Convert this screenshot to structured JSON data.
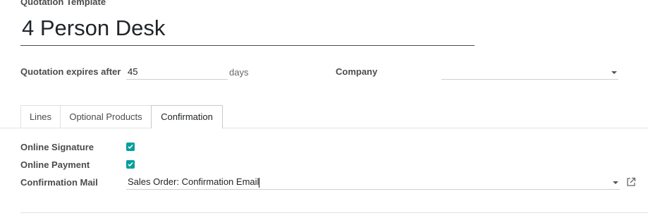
{
  "form": {
    "section_label": "Quotation Template",
    "name_value": "4 Person Desk",
    "expires_label": "Quotation expires after",
    "expires_value": "45",
    "expires_unit": "days",
    "company_label": "Company",
    "company_value": ""
  },
  "tabs": [
    {
      "label": "Lines",
      "active": false
    },
    {
      "label": "Optional Products",
      "active": false
    },
    {
      "label": "Confirmation",
      "active": true
    }
  ],
  "confirmation": {
    "online_signature_label": "Online Signature",
    "online_signature_checked": true,
    "online_payment_label": "Online Payment",
    "online_payment_checked": true,
    "confirmation_mail_label": "Confirmation Mail",
    "confirmation_mail_value": "Sales Order: Confirmation Email"
  },
  "icons": {
    "checkbox": "checkmark-icon",
    "dropdown": "caret-down-icon",
    "external": "external-link-icon"
  },
  "colors": {
    "accent": "#00a09d"
  }
}
